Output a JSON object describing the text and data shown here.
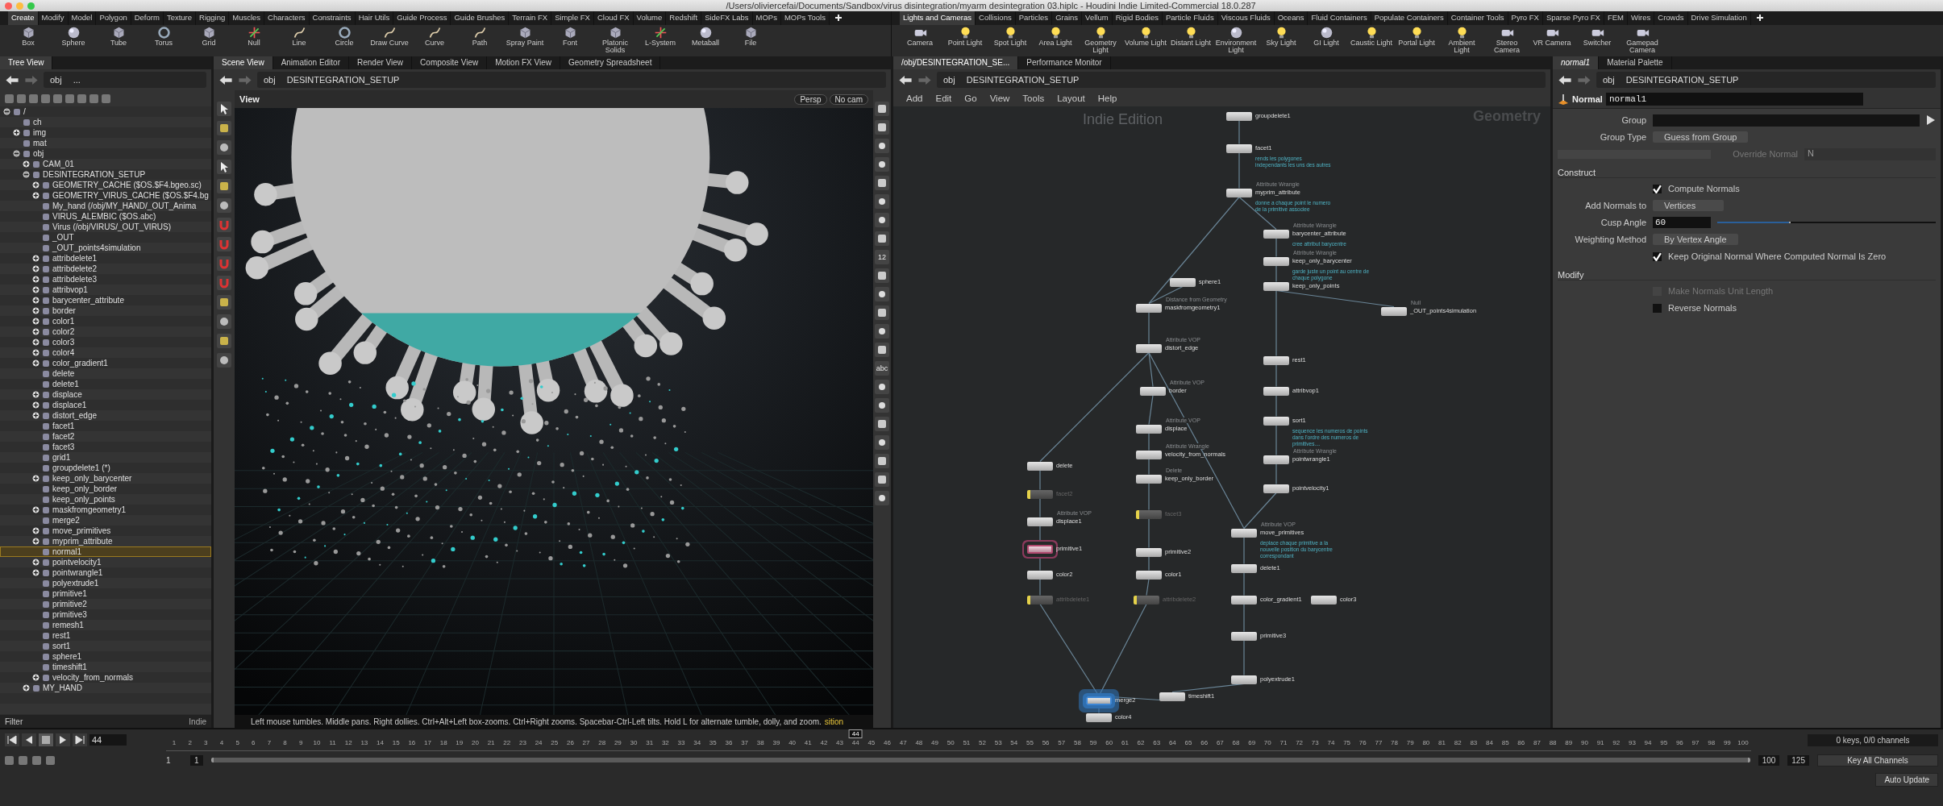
{
  "window": {
    "title": "/Users/oliviercefai/Documents/Sandbox/virus disintegration/myarm desintegration 03.hiplc - Houdini Indie Limited-Commercial 18.0.287"
  },
  "shelves": [
    {
      "tabs": [
        {
          "label": "Create",
          "selected": true
        },
        {
          "label": "Modify",
          "selected": false
        },
        {
          "label": "Model",
          "selected": false
        },
        {
          "label": "Polygon",
          "selected": false
        },
        {
          "label": "Deform",
          "selected": false
        },
        {
          "label": "Texture",
          "selected": false
        },
        {
          "label": "Rigging",
          "selected": false
        },
        {
          "label": "Muscles",
          "selected": false
        },
        {
          "label": "Characters",
          "selected": false
        },
        {
          "label": "Constraints",
          "selected": false
        },
        {
          "label": "Hair Utils",
          "selected": false
        },
        {
          "label": "Guide Process",
          "selected": false
        },
        {
          "label": "Guide Brushes",
          "selected": false
        },
        {
          "label": "Terrain FX",
          "selected": false
        },
        {
          "label": "Simple FX",
          "selected": false
        },
        {
          "label": "Cloud FX",
          "selected": false
        },
        {
          "label": "Volume",
          "selected": false
        },
        {
          "label": "Redshift",
          "selected": false
        },
        {
          "label": "SideFX Labs",
          "selected": false
        },
        {
          "label": "MOPs",
          "selected": false
        },
        {
          "label": "MOPs Tools",
          "selected": false
        }
      ],
      "tools": [
        "Box",
        "Sphere",
        "Tube",
        "Torus",
        "Grid",
        "Null",
        "Line",
        "Circle",
        "Draw Curve",
        "Curve",
        "Path",
        "Spray Paint",
        "Font",
        "Platonic Solids",
        "L-System",
        "Metaball",
        "File"
      ]
    },
    {
      "tabs": [
        {
          "label": "Lights and Cameras",
          "selected": true
        },
        {
          "label": "Collisions",
          "selected": false
        },
        {
          "label": "Particles",
          "selected": false
        },
        {
          "label": "Grains",
          "selected": false
        },
        {
          "label": "Vellum",
          "selected": false
        },
        {
          "label": "Rigid Bodies",
          "selected": false
        },
        {
          "label": "Particle Fluids",
          "selected": false
        },
        {
          "label": "Viscous Fluids",
          "selected": false
        },
        {
          "label": "Oceans",
          "selected": false
        },
        {
          "label": "Fluid Containers",
          "selected": false
        },
        {
          "label": "Populate Containers",
          "selected": false
        },
        {
          "label": "Container Tools",
          "selected": false
        },
        {
          "label": "Pyro FX",
          "selected": false
        },
        {
          "label": "Sparse Pyro FX",
          "selected": false
        },
        {
          "label": "FEM",
          "selected": false
        },
        {
          "label": "Wires",
          "selected": false
        },
        {
          "label": "Crowds",
          "selected": false
        },
        {
          "label": "Drive Simulation",
          "selected": false
        }
      ],
      "tools": [
        "Camera",
        "Point Light",
        "Spot Light",
        "Area Light",
        "Geometry Light",
        "Volume Light",
        "Distant Light",
        "Environment Light",
        "Sky Light",
        "GI Light",
        "Caustic Light",
        "Portal Light",
        "Ambient Light",
        "Stereo Camera",
        "VR Camera",
        "Switcher",
        "Gamepad Camera"
      ]
    }
  ],
  "tree_view": {
    "tabs": [
      {
        "label": "Tree View",
        "selected": true
      }
    ],
    "path": [
      "obj",
      "..."
    ],
    "filter_label": "Filter",
    "edition_label": "Indie",
    "items": [
      {
        "label": "/",
        "expandable": true,
        "expanded": true,
        "selected": false,
        "children": [
          {
            "label": "ch",
            "expandable": false,
            "expanded": false,
            "selected": false
          },
          {
            "label": "img",
            "expandable": true,
            "expanded": false,
            "selected": false
          },
          {
            "label": "mat",
            "expandable": false,
            "expanded": false,
            "selected": false
          },
          {
            "label": "obj",
            "expandable": true,
            "expanded": true,
            "selected": false,
            "children": [
              {
                "label": "CAM_01",
                "expandable": true,
                "expanded": false,
                "selected": false
              },
              {
                "label": "DESINTEGRATION_SETUP",
                "expandable": true,
                "expanded": true,
                "selected": false,
                "children": [
                  {
                    "label": "GEOMETRY_CACHE ($OS.$F4.bgeo.sc)",
                    "expandable": true,
                    "expanded": false,
                    "selected": false
                  },
                  {
                    "label": "GEOMETRY_VIRUS_CACHE ($OS.$F4.bg",
                    "expandable": true,
                    "expanded": false,
                    "selected": false
                  },
                  {
                    "label": "My_hand (/obj/MY_HAND/_OUT_Anima",
                    "expandable": false,
                    "expanded": false,
                    "selected": false
                  },
                  {
                    "label": "VIRUS_ALEMBIC ($OS.abc)",
                    "expandable": false,
                    "expanded": false,
                    "selected": false
                  },
                  {
                    "label": "Virus (/obj/VIRUS/_OUT_VIRUS)",
                    "expandable": false,
                    "expanded": false,
                    "selected": false
                  },
                  {
                    "label": "_OUT",
                    "expandable": false,
                    "expanded": false,
                    "selected": false
                  },
                  {
                    "label": "_OUT_points4simulation",
                    "expandable": false,
                    "expanded": false,
                    "selected": false
                  },
                  {
                    "label": "attribdelete1",
                    "expandable": true,
                    "expanded": false,
                    "selected": false
                  },
                  {
                    "label": "attribdelete2",
                    "expandable": true,
                    "expanded": false,
                    "selected": false
                  },
                  {
                    "label": "attribdelete3",
                    "expandable": true,
                    "expanded": false,
                    "selected": false
                  },
                  {
                    "label": "attribvop1",
                    "expandable": true,
                    "expanded": false,
                    "selected": false
                  },
                  {
                    "label": "barycenter_attribute",
                    "expandable": true,
                    "expanded": false,
                    "selected": false
                  },
                  {
                    "label": "border",
                    "expandable": true,
                    "expanded": false,
                    "selected": false
                  },
                  {
                    "label": "color1",
                    "expandable": true,
                    "expanded": false,
                    "selected": false
                  },
                  {
                    "label": "color2",
                    "expandable": true,
                    "expanded": false,
                    "selected": false
                  },
                  {
                    "label": "color3",
                    "expandable": true,
                    "expanded": false,
                    "selected": false
                  },
                  {
                    "label": "color4",
                    "expandable": true,
                    "expanded": false,
                    "selected": false
                  },
                  {
                    "label": "color_gradient1",
                    "expandable": true,
                    "expanded": false,
                    "selected": false
                  },
                  {
                    "label": "delete",
                    "expandable": false,
                    "expanded": false,
                    "selected": false
                  },
                  {
                    "label": "delete1",
                    "expandable": false,
                    "expanded": false,
                    "selected": false
                  },
                  {
                    "label": "displace",
                    "expandable": true,
                    "expanded": false,
                    "selected": false
                  },
                  {
                    "label": "displace1",
                    "expandable": true,
                    "expanded": false,
                    "selected": false
                  },
                  {
                    "label": "distort_edge",
                    "expandable": true,
                    "expanded": false,
                    "selected": false
                  },
                  {
                    "label": "facet1",
                    "expandable": false,
                    "expanded": false,
                    "selected": false
                  },
                  {
                    "label": "facet2",
                    "expandable": false,
                    "expanded": false,
                    "selected": false
                  },
                  {
                    "label": "facet3",
                    "expandable": false,
                    "expanded": false,
                    "selected": false
                  },
                  {
                    "label": "grid1",
                    "expandable": false,
                    "expanded": false,
                    "selected": false
                  },
                  {
                    "label": "groupdelete1 (*)",
                    "expandable": false,
                    "expanded": false,
                    "selected": false
                  },
                  {
                    "label": "keep_only_barycenter",
                    "expandable": true,
                    "expanded": false,
                    "selected": false
                  },
                  {
                    "label": "keep_only_border",
                    "expandable": false,
                    "expanded": false,
                    "selected": false
                  },
                  {
                    "label": "keep_only_points",
                    "expandable": false,
                    "expanded": false,
                    "selected": false
                  },
                  {
                    "label": "maskfromgeometry1",
                    "expandable": true,
                    "expanded": false,
                    "selected": false
                  },
                  {
                    "label": "merge2",
                    "expandable": false,
                    "expanded": false,
                    "selected": false
                  },
                  {
                    "label": "move_primitives",
                    "expandable": true,
                    "expanded": false,
                    "selected": false
                  },
                  {
                    "label": "myprim_attribute",
                    "expandable": true,
                    "expanded": false,
                    "selected": false
                  },
                  {
                    "label": "normal1",
                    "expandable": false,
                    "expanded": false,
                    "selected": true
                  },
                  {
                    "label": "pointvelocity1",
                    "expandable": true,
                    "expanded": false,
                    "selected": false
                  },
                  {
                    "label": "pointwrangle1",
                    "expandable": true,
                    "expanded": false,
                    "selected": false
                  },
                  {
                    "label": "polyextrude1",
                    "expandable": false,
                    "expanded": false,
                    "selected": false
                  },
                  {
                    "label": "primitive1",
                    "expandable": false,
                    "expanded": false,
                    "selected": false
                  },
                  {
                    "label": "primitive2",
                    "expandable": false,
                    "expanded": false,
                    "selected": false
                  },
                  {
                    "label": "primitive3",
                    "expandable": false,
                    "expanded": false,
                    "selected": false
                  },
                  {
                    "label": "remesh1",
                    "expandable": false,
                    "expanded": false,
                    "selected": false
                  },
                  {
                    "label": "rest1",
                    "expandable": false,
                    "expanded": false,
                    "selected": false
                  },
                  {
                    "label": "sort1",
                    "expandable": false,
                    "expanded": false,
                    "selected": false
                  },
                  {
                    "label": "sphere1",
                    "expandable": false,
                    "expanded": false,
                    "selected": false
                  },
                  {
                    "label": "timeshift1",
                    "expandable": false,
                    "expanded": false,
                    "selected": false
                  },
                  {
                    "label": "velocity_from_normals",
                    "expandable": true,
                    "expanded": false,
                    "selected": false
                  }
                ]
              },
              {
                "label": "MY_HAND",
                "expandable": true,
                "expanded": false,
                "selected": false
              }
            ]
          }
        ]
      }
    ]
  },
  "scene_view": {
    "tabs": [
      {
        "label": "Scene View",
        "selected": true
      },
      {
        "label": "Animation Editor",
        "selected": false
      },
      {
        "label": "Render View",
        "selected": false
      },
      {
        "label": "Composite View",
        "selected": false
      },
      {
        "label": "Motion FX View",
        "selected": false
      },
      {
        "label": "Geometry Spreadsheet",
        "selected": false
      }
    ],
    "path": [
      "obj",
      "DESINTEGRATION_SETUP"
    ],
    "view_label": "View",
    "camera_buttons": [
      "Persp",
      "No cam"
    ],
    "status": "Left mouse tumbles. Middle pans. Right dollies. Ctrl+Alt+Left box-zooms. Ctrl+Right zooms. Spacebar-Ctrl-Left tilts. Hold L for alternate tumble, dolly, and zoom.",
    "status_tail": "sition",
    "side_labels": [
      "12",
      "abc"
    ]
  },
  "network": {
    "tabs": [
      {
        "label": "/obj/DESINTEGRATION_SE...",
        "selected": true
      },
      {
        "label": "Performance Monitor",
        "selected": false
      }
    ],
    "path": [
      "obj",
      "DESINTEGRATION_SETUP"
    ],
    "menu": [
      "Add",
      "Edit",
      "Go",
      "View",
      "Tools",
      "Layout",
      "Help"
    ],
    "watermark": "Indie Edition",
    "context_label": "Geometry",
    "nodes": [
      {
        "name": "groupdelete1",
        "bypassed": false,
        "display": false,
        "marked": false
      },
      {
        "name": "facet1",
        "comment": "rends les polygones independants les uns des autres",
        "bypassed": false,
        "display": false,
        "marked": false
      },
      {
        "name": "myprim_attribute",
        "type": "Attribute Wrangle",
        "comment": "donne a chaque point le numero de la primitive associee",
        "bypassed": false,
        "display": false,
        "marked": false
      },
      {
        "name": "barycenter_attribute",
        "type": "Attribute Wrangle",
        "comment": "cree attribut barycentre",
        "bypassed": false,
        "display": false,
        "marked": false
      },
      {
        "name": "keep_only_barycenter",
        "type": "Attribute Wrangle",
        "comment": "garde juste un point au centre de chaque polygone",
        "bypassed": false,
        "display": false,
        "marked": false
      },
      {
        "name": "keep_only_points",
        "bypassed": false,
        "display": false,
        "marked": false
      },
      {
        "name": "sphere1",
        "bypassed": false,
        "display": false,
        "marked": false
      },
      {
        "name": "maskfromgeometry1",
        "type": "Distance from Geometry",
        "bypassed": false,
        "display": false,
        "marked": false
      },
      {
        "name": "_OUT_points4simulation",
        "type": "Null",
        "bypassed": false,
        "display": false,
        "marked": false
      },
      {
        "name": "distort_edge",
        "type": "Attribute VOP",
        "bypassed": false,
        "display": false,
        "marked": false
      },
      {
        "name": "rest1",
        "bypassed": false,
        "display": false,
        "marked": false
      },
      {
        "name": "border",
        "type": "Attribute VOP",
        "bypassed": false,
        "display": false,
        "marked": false
      },
      {
        "name": "attribvop1",
        "bypassed": false,
        "display": false,
        "marked": false
      },
      {
        "name": "displace",
        "type": "Attribute VOP",
        "bypassed": false,
        "display": false,
        "marked": false
      },
      {
        "name": "sort1",
        "comment": "sequence les numeros de points dans l'ordre des numeros de primitives....",
        "bypassed": false,
        "display": false,
        "marked": false
      },
      {
        "name": "velocity_from_normals",
        "type": "Attribute Wrangle",
        "bypassed": false,
        "display": false,
        "marked": false
      },
      {
        "name": "pointwrangle1",
        "type": "Attribute Wrangle",
        "bypassed": false,
        "display": false,
        "marked": false
      },
      {
        "name": "delete",
        "bypassed": false,
        "display": false,
        "marked": false
      },
      {
        "name": "keep_only_border",
        "type": "Delete",
        "bypassed": false,
        "display": false,
        "marked": false
      },
      {
        "name": "pointvelocity1",
        "bypassed": false,
        "display": false,
        "marked": false
      },
      {
        "name": "facet2",
        "bypassed": true,
        "display": false,
        "marked": false
      },
      {
        "name": "facet3",
        "bypassed": true,
        "display": false,
        "marked": false
      },
      {
        "name": "displace1",
        "type": "Attribute VOP",
        "bypassed": false,
        "display": false,
        "marked": false
      },
      {
        "name": "move_primitives",
        "type": "Attribute VOP",
        "comment": "deplace chaque primitive a la nouvelle position du barycentre correspondant",
        "bypassed": false,
        "display": false,
        "marked": false
      },
      {
        "name": "primitive1",
        "bypassed": false,
        "display": false,
        "marked": true
      },
      {
        "name": "primitive2",
        "bypassed": false,
        "display": false,
        "marked": false
      },
      {
        "name": "delete1",
        "bypassed": false,
        "display": false,
        "marked": false
      },
      {
        "name": "color2",
        "bypassed": false,
        "display": false,
        "marked": false
      },
      {
        "name": "color1",
        "bypassed": false,
        "display": false,
        "marked": false
      },
      {
        "name": "attribdelete1",
        "bypassed": true,
        "display": false,
        "marked": false
      },
      {
        "name": "attribdelete2",
        "bypassed": true,
        "display": false,
        "marked": false
      },
      {
        "name": "color_gradient1",
        "bypassed": false,
        "display": false,
        "marked": false
      },
      {
        "name": "color3",
        "bypassed": false,
        "display": false,
        "marked": false
      },
      {
        "name": "primitive3",
        "bypassed": false,
        "display": false,
        "marked": false
      },
      {
        "name": "polyextrude1",
        "bypassed": false,
        "display": false,
        "marked": false
      },
      {
        "name": "timeshift1",
        "bypassed": false,
        "display": false,
        "marked": false
      },
      {
        "name": "merge2",
        "bypassed": false,
        "display": true,
        "marked": false
      },
      {
        "name": "color4",
        "bypassed": false,
        "display": false,
        "marked": false
      }
    ]
  },
  "parameters": {
    "tabs": [
      {
        "label": "normal1",
        "selected": true
      },
      {
        "label": "Material Palette",
        "selected": false
      }
    ],
    "path": [
      "obj",
      "DESINTEGRATION_SETUP"
    ],
    "node_type": "Normal",
    "node_name": "normal1",
    "rows": [
      {
        "kind": "field",
        "label": "Group"
      },
      {
        "kind": "menu",
        "label": "Group Type",
        "value": "Guess from Group"
      },
      {
        "kind": "toggle_field",
        "label": "Override Normal",
        "value": "N",
        "checked": false,
        "disabled": true
      },
      {
        "kind": "section",
        "label": "Construct"
      },
      {
        "kind": "checkbox",
        "label": "Compute Normals",
        "checked": true,
        "disabled": false
      },
      {
        "kind": "menu",
        "label": "Add Normals to",
        "value": "Vertices"
      },
      {
        "kind": "slider",
        "label": "Cusp Angle",
        "value": "60",
        "level": 0.33
      },
      {
        "kind": "menu",
        "label": "Weighting Method",
        "value": "By Vertex Angle"
      },
      {
        "kind": "checkbox",
        "label": "Keep Original Normal Where Computed Normal Is Zero",
        "checked": true,
        "disabled": false
      },
      {
        "kind": "section",
        "label": "Modify"
      },
      {
        "kind": "checkbox",
        "label": "Make Normals Unit Length",
        "checked": false,
        "disabled": true
      },
      {
        "kind": "checkbox",
        "label": "Reverse Normals",
        "checked": false,
        "disabled": false
      }
    ]
  },
  "timeline": {
    "frame": "44",
    "playhead": {
      "label": "44",
      "level": 0.4343
    },
    "labels": [
      "1",
      "2",
      "3",
      "4",
      "5",
      "6",
      "7",
      "8",
      "9",
      "10",
      "11",
      "12",
      "13",
      "14",
      "15",
      "16",
      "17",
      "18",
      "19",
      "20",
      "21",
      "22",
      "23",
      "24",
      "25",
      "26",
      "27",
      "28",
      "29",
      "30",
      "31",
      "32",
      "33",
      "34",
      "35",
      "36",
      "37",
      "38",
      "39",
      "40",
      "41",
      "42",
      "43",
      "44",
      "45",
      "46",
      "47",
      "48",
      "49",
      "50",
      "51",
      "52",
      "53",
      "54",
      "55",
      "56",
      "57",
      "58",
      "59",
      "60",
      "61",
      "62",
      "63",
      "64",
      "65",
      "66",
      "67",
      "68",
      "69",
      "70",
      "71",
      "72",
      "73",
      "74",
      "75",
      "76",
      "77",
      "78",
      "79",
      "80",
      "81",
      "82",
      "83",
      "84",
      "85",
      "86",
      "87",
      "88",
      "89",
      "90",
      "91",
      "92",
      "93",
      "94",
      "95",
      "96",
      "97",
      "98",
      "99",
      "100"
    ],
    "range": {
      "level": 1
    },
    "range_start": "1",
    "range_start_field": "1",
    "range_end": "100",
    "range_end_field": "125",
    "keys_info": "0 keys, 0/0 channels",
    "key_button": "Key All Channels",
    "auto_update": "Auto Update"
  }
}
